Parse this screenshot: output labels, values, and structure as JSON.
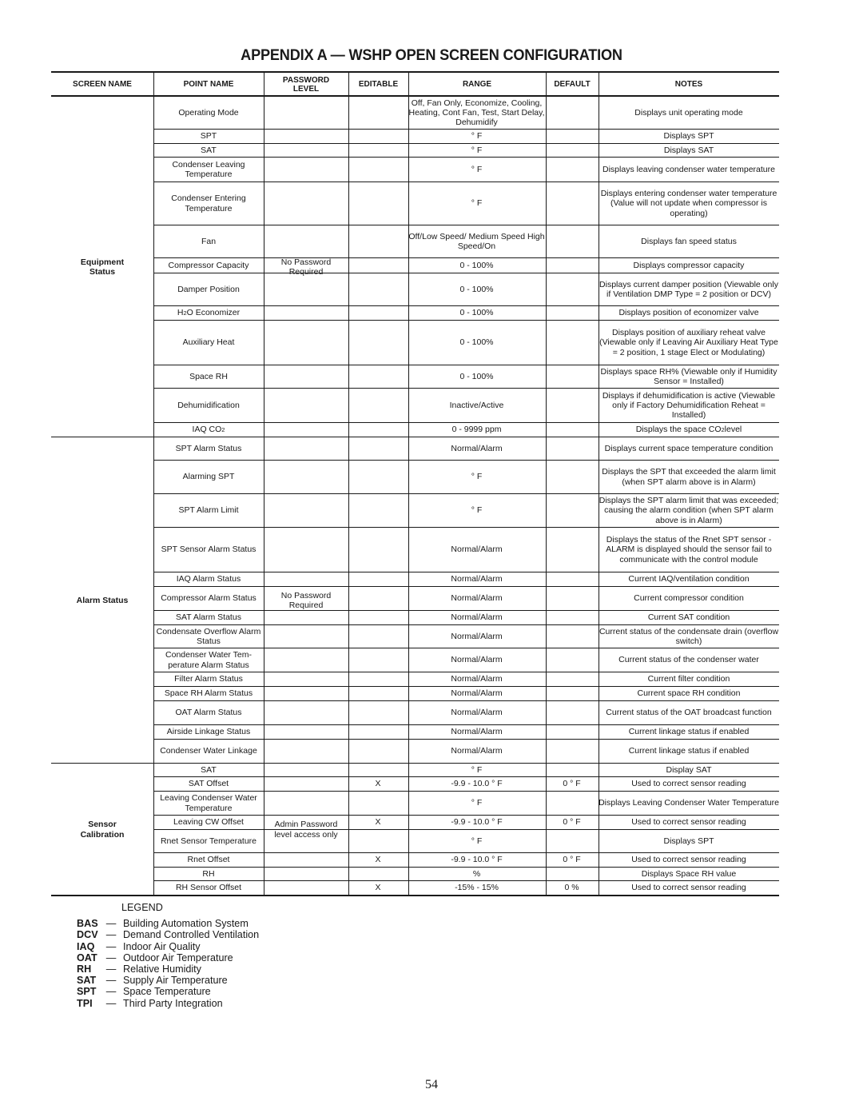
{
  "page": {
    "title": "APPENDIX A — WSHP OPEN SCREEN CONFIGURATION",
    "page_number": "54"
  },
  "table": {
    "headers": {
      "screen_name": "SCREEN NAME",
      "point_name": "POINT NAME",
      "password_level_line1": "PASSWORD",
      "password_level_line2": "LEVEL",
      "editable": "EDITABLE",
      "range": "RANGE",
      "default": "DEFAULT",
      "notes": "NOTES"
    },
    "groups": [
      {
        "screen_name": "Equipment Status",
        "password_level": "No Password Required",
        "rows": [
          {
            "point": "Operating Mode",
            "editable": "",
            "range": "Off, Fan Only, Economize, Cooling, Heating, Cont Fan, Test, Start Delay, Dehumidify",
            "default": "",
            "notes": "Displays unit operating mode"
          },
          {
            "point": "SPT",
            "editable": "",
            "range": "° F",
            "default": "",
            "notes": "Displays SPT"
          },
          {
            "point": "SAT",
            "editable": "",
            "range": "° F",
            "default": "",
            "notes": "Displays SAT"
          },
          {
            "point": "Condenser Leaving Temperature",
            "editable": "",
            "range": "° F",
            "default": "",
            "notes": "Displays leaving condenser water temperature"
          },
          {
            "point": "Condenser Entering Temperature",
            "editable": "",
            "range": "° F",
            "default": "",
            "notes": "Displays entering condenser water temperature (Value will not update when compressor is operating)"
          },
          {
            "point": "Fan",
            "editable": "",
            "range": "Off/Low Speed/ Medium Speed High Speed/On",
            "default": "",
            "notes": "Displays fan speed status"
          },
          {
            "point": "Compressor Capacity",
            "editable": "",
            "range": "0 - 100%",
            "default": "",
            "notes": "Displays compressor capacity"
          },
          {
            "point": "Damper Position",
            "editable": "",
            "range": "0 - 100%",
            "default": "",
            "notes": "Displays current damper position (Viewable only if Ventilation DMP Type = 2 position or DCV)"
          },
          {
            "point": "H2O Economizer",
            "editable": "",
            "range": "0 - 100%",
            "default": "",
            "notes": "Displays position of economizer valve"
          },
          {
            "point": "Auxiliary Heat",
            "editable": "",
            "range": "0 - 100%",
            "default": "",
            "notes": "Displays position of auxiliary reheat valve (Viewable only if Leaving Air Auxiliary Heat Type = 2 position, 1 stage Elect or Modulating)"
          },
          {
            "point": "Space RH",
            "editable": "",
            "range": "0 - 100%",
            "default": "",
            "notes": "Displays space RH% (Viewable only if Humidity Sensor = Installed)"
          },
          {
            "point": "Dehumidification",
            "editable": "",
            "range": "Inactive/Active",
            "default": "",
            "notes": "Displays if dehumidification is active (Viewable only if Factory Dehumidification Reheat = Installed)"
          },
          {
            "point": "IAQ CO2",
            "editable": "",
            "range": "0 - 9999 ppm",
            "default": "",
            "notes": "Displays the space CO2 level"
          }
        ]
      },
      {
        "screen_name": "Alarm Status",
        "password_level": "No Password Required",
        "rows": [
          {
            "point": "SPT Alarm Status",
            "editable": "",
            "range": "Normal/Alarm",
            "default": "",
            "notes": "Displays current space temperature condition"
          },
          {
            "point": "Alarming SPT",
            "editable": "",
            "range": "° F",
            "default": "",
            "notes": "Displays the SPT that exceeded the alarm limit (when SPT alarm above is in Alarm)"
          },
          {
            "point": "SPT Alarm Limit",
            "editable": "",
            "range": "° F",
            "default": "",
            "notes": "Displays the SPT alarm limit that was exceeded; causing the alarm condition (when SPT alarm above is in Alarm)"
          },
          {
            "point": "SPT Sensor Alarm Status",
            "editable": "",
            "range": "Normal/Alarm",
            "default": "",
            "notes": "Displays the status of the Rnet SPT sensor - ALARM is displayed should the sensor fail to communicate with the control module"
          },
          {
            "point": "IAQ Alarm Status",
            "editable": "",
            "range": "Normal/Alarm",
            "default": "",
            "notes": "Current IAQ/ventilation condition"
          },
          {
            "point": "Compressor Alarm Status",
            "editable": "",
            "range": "Normal/Alarm",
            "default": "",
            "notes": "Current compressor condition"
          },
          {
            "point": "SAT Alarm Status",
            "editable": "",
            "range": "Normal/Alarm",
            "default": "",
            "notes": "Current SAT condition"
          },
          {
            "point": "Condensate Overflow Alarm Status",
            "editable": "",
            "range": "Normal/Alarm",
            "default": "",
            "notes": "Current status of the condensate drain (overflow switch)"
          },
          {
            "point": "Condenser Water Tem- perature Alarm Status",
            "editable": "",
            "range": "Normal/Alarm",
            "default": "",
            "notes": "Current status of the condenser water"
          },
          {
            "point": "Filter Alarm Status",
            "editable": "",
            "range": "Normal/Alarm",
            "default": "",
            "notes": "Current filter condition"
          },
          {
            "point": "Space RH Alarm Status",
            "editable": "",
            "range": "Normal/Alarm",
            "default": "",
            "notes": "Current space RH condition"
          },
          {
            "point": "OAT Alarm Status",
            "editable": "",
            "range": "Normal/Alarm",
            "default": "",
            "notes": "Current status of the OAT broadcast function"
          },
          {
            "point": "Airside Linkage Status",
            "editable": "",
            "range": "Normal/Alarm",
            "default": "",
            "notes": "Current linkage status if enabled"
          },
          {
            "point": "Condenser Water Linkage",
            "editable": "",
            "range": "Normal/Alarm",
            "default": "",
            "notes": "Current linkage status if enabled"
          }
        ]
      },
      {
        "screen_name": "Sensor Calibration",
        "password_level": "Admin Password level access only",
        "rows": [
          {
            "point": "SAT",
            "editable": "",
            "range": "° F",
            "default": "",
            "notes": "Display SAT"
          },
          {
            "point": "SAT Offset",
            "editable": "X",
            "range": "-9.9 - 10.0 ° F",
            "default": "0 ° F",
            "notes": "Used to correct sensor reading"
          },
          {
            "point": "Leaving Condenser Water Temperature",
            "editable": "",
            "range": "° F",
            "default": "",
            "notes": "Displays Leaving Condenser Water Temperature"
          },
          {
            "point": "Leaving CW Offset",
            "editable": "X",
            "range": "-9.9 - 10.0  ° F",
            "default": "0 ° F",
            "notes": "Used to correct sensor reading"
          },
          {
            "point": "Rnet Sensor Temperature",
            "editable": "",
            "range": "° F",
            "default": "",
            "notes": "Displays SPT"
          },
          {
            "point": "Rnet Offset",
            "editable": "X",
            "range": "-9.9 - 10.0  ° F",
            "default": "0 ° F",
            "notes": "Used to correct sensor reading"
          },
          {
            "point": "RH",
            "editable": "",
            "range": "%",
            "default": "",
            "notes": "Displays Space RH value"
          },
          {
            "point": "RH Sensor Offset",
            "editable": "X",
            "range": "-15% - 15%",
            "default": "0 %",
            "notes": "Used to correct sensor reading"
          }
        ]
      }
    ]
  },
  "legend": {
    "title": "LEGEND",
    "items": [
      {
        "abbr": "BAS",
        "dash": "—",
        "meaning": "Building Automation System"
      },
      {
        "abbr": "DCV",
        "dash": "—",
        "meaning": "Demand Controlled Ventilation"
      },
      {
        "abbr": "IAQ",
        "dash": "—",
        "meaning": "Indoor Air Quality"
      },
      {
        "abbr": "OAT",
        "dash": "—",
        "meaning": "Outdoor Air Temperature"
      },
      {
        "abbr": "RH",
        "dash": "—",
        "meaning": "Relative Humidity"
      },
      {
        "abbr": "SAT",
        "dash": "—",
        "meaning": "Supply Air Temperature"
      },
      {
        "abbr": "SPT",
        "dash": "—",
        "meaning": "Space Temperature"
      },
      {
        "abbr": "TPI",
        "dash": "—",
        "meaning": "Third Party Integration"
      }
    ]
  }
}
